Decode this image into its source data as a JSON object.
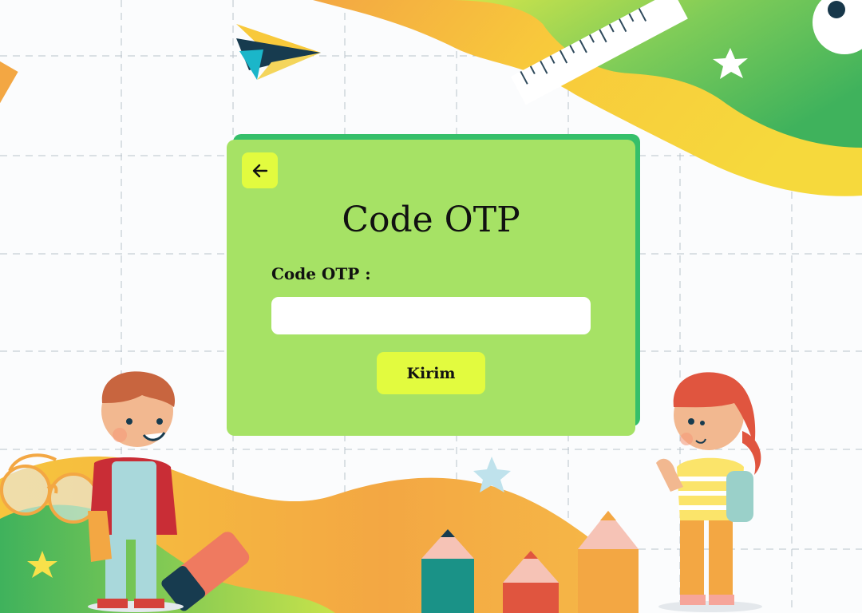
{
  "page": {
    "title": "Code OTP",
    "background": "#fbfcfd"
  },
  "form": {
    "back_icon": "arrow-left-icon",
    "field_label": "Code OTP :",
    "otp_value": "",
    "otp_placeholder": "",
    "submit_label": "Kirim"
  },
  "colors": {
    "card": "#a6e265",
    "card_shadow": "#35bf6a",
    "button": "#e2fb3f",
    "wave_orange": "#f3a743",
    "wave_yellow": "#f8c93b",
    "wave_green": "#4cb85c"
  },
  "decorations": {
    "icons": [
      "paper-plane-icon",
      "ruler-icon",
      "pencil-icon",
      "star-icon",
      "glasses-icon",
      "eraser-icon",
      "boy-illustration",
      "girl-illustration"
    ]
  }
}
